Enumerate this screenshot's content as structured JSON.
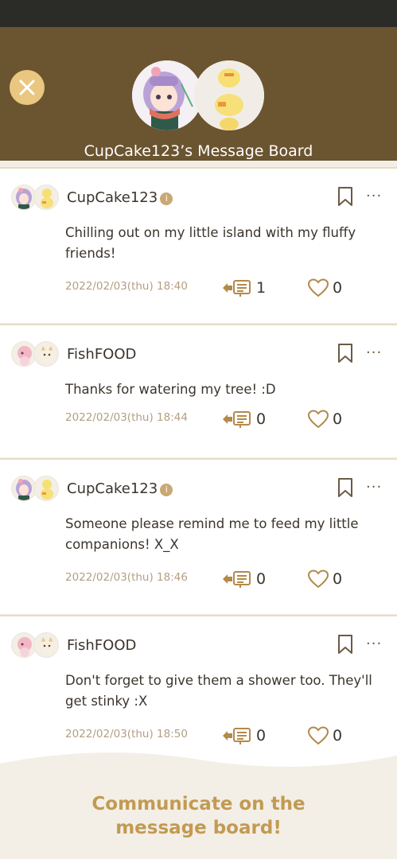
{
  "header": {
    "title": "CupCake123’s Message Board",
    "close_icon": "close-icon"
  },
  "posts": [
    {
      "author": "CupCake123",
      "badge": "i",
      "message": "Chilling out on my little island with my fluffy friends!",
      "timestamp": "2022/02/03(thu) 18:40",
      "comments": "1",
      "likes": "0"
    },
    {
      "author": "FishFOOD",
      "message": "Thanks for watering my tree! :D",
      "timestamp": "2022/02/03(thu) 18:44",
      "comments": "0",
      "likes": "0"
    },
    {
      "author": "CupCake123",
      "badge": "i",
      "message": "Someone please remind me to feed my little companions! X_X",
      "timestamp": "2022/02/03(thu) 18:46",
      "comments": "0",
      "likes": "0"
    },
    {
      "author": "FishFOOD",
      "message": "Don't forget to give them a shower too. They'll get stinky :X",
      "timestamp": "2022/02/03(thu) 18:50",
      "comments": "0",
      "likes": "0"
    }
  ],
  "more_label": "···",
  "caption": "Communicate on the message board!",
  "colors": {
    "header_bg": "#6b5430",
    "accent": "#c39a52",
    "close_bg": "#e9c780"
  }
}
